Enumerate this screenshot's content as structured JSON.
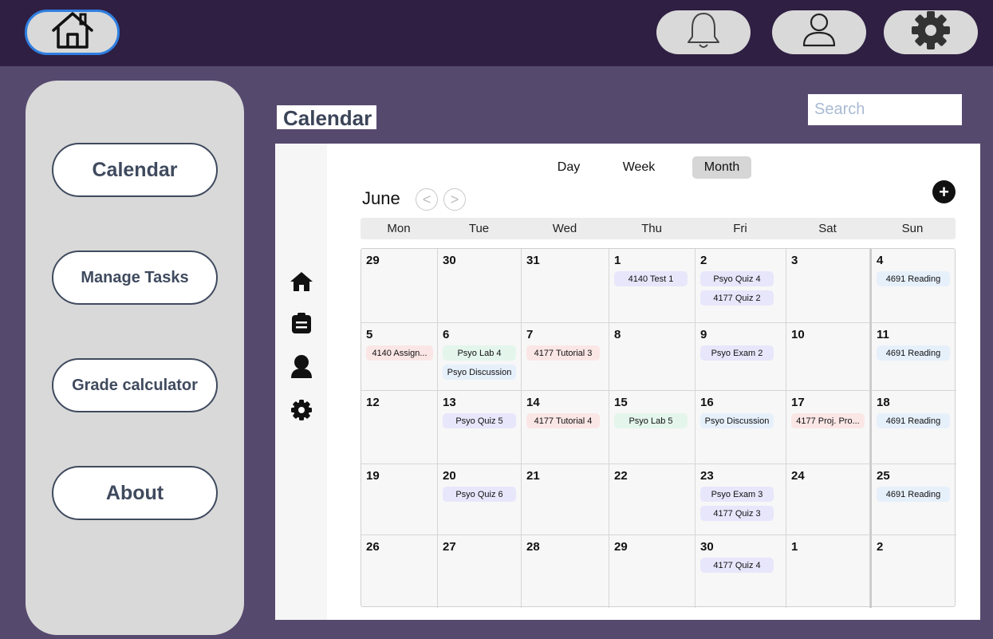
{
  "topbar": {
    "home_icon": "home-icon",
    "bell_icon": "bell-icon",
    "user_icon": "user-icon",
    "gear_icon": "gear-icon",
    "accent": "#2f7fe0"
  },
  "sidebar": {
    "items": [
      {
        "label": "Calendar"
      },
      {
        "label": "Manage Tasks"
      },
      {
        "label": "Grade calculator"
      },
      {
        "label": "About"
      }
    ]
  },
  "page": {
    "title": "Calendar"
  },
  "search": {
    "placeholder": "Search",
    "value": ""
  },
  "rail": {
    "icons": [
      "home-icon",
      "clipboard-icon",
      "person-icon",
      "gear-icon"
    ]
  },
  "calendar": {
    "views": [
      "Day",
      "Week",
      "Month"
    ],
    "active_view": "Month",
    "month": "June",
    "prev_label": "<",
    "next_label": ">",
    "add_label": "+",
    "weekdays": [
      "Mon",
      "Tue",
      "Wed",
      "Thu",
      "Fri",
      "Sat",
      "Sun"
    ],
    "weeks": [
      [
        {
          "day": "29",
          "events": []
        },
        {
          "day": "30",
          "events": []
        },
        {
          "day": "31",
          "events": []
        },
        {
          "day": "1",
          "events": [
            {
              "title": "4140 Test 1",
              "color": "#e8e6fb"
            }
          ]
        },
        {
          "day": "2",
          "events": [
            {
              "title": "Psyo Quiz 4",
              "color": "#e8e6fb"
            },
            {
              "title": "4177 Quiz 2",
              "color": "#e8e6fb"
            }
          ]
        },
        {
          "day": "3",
          "events": []
        },
        {
          "day": "4",
          "events": [
            {
              "title": "4691 Reading",
              "color": "#e6f0fb"
            }
          ]
        }
      ],
      [
        {
          "day": "5",
          "events": [
            {
              "title": "4140 Assign...",
              "color": "#fbe6e6"
            }
          ]
        },
        {
          "day": "6",
          "events": [
            {
              "title": "Psyo Lab 4",
              "color": "#e4f6ec"
            },
            {
              "title": "Psyo Discussion",
              "color": "#e6f0fb"
            }
          ]
        },
        {
          "day": "7",
          "events": [
            {
              "title": "4177 Tutorial 3",
              "color": "#fbe6e6"
            }
          ]
        },
        {
          "day": "8",
          "events": []
        },
        {
          "day": "9",
          "events": [
            {
              "title": "Psyo Exam 2",
              "color": "#e8e6fb"
            }
          ]
        },
        {
          "day": "10",
          "events": []
        },
        {
          "day": "11",
          "events": [
            {
              "title": "4691 Reading",
              "color": "#e6f0fb"
            }
          ]
        }
      ],
      [
        {
          "day": "12",
          "events": []
        },
        {
          "day": "13",
          "events": [
            {
              "title": "Psyo Quiz 5",
              "color": "#e8e6fb"
            }
          ]
        },
        {
          "day": "14",
          "events": [
            {
              "title": "4177 Tutorial 4",
              "color": "#fbe6e6"
            }
          ]
        },
        {
          "day": "15",
          "events": [
            {
              "title": "Psyo Lab 5",
              "color": "#e4f6ec"
            }
          ]
        },
        {
          "day": "16",
          "events": [
            {
              "title": "Psyo Discussion",
              "color": "#e6f0fb"
            }
          ]
        },
        {
          "day": "17",
          "events": [
            {
              "title": "4177 Proj. Pro...",
              "color": "#fbe6e6"
            }
          ]
        },
        {
          "day": "18",
          "events": [
            {
              "title": "4691 Reading",
              "color": "#e6f0fb"
            }
          ]
        }
      ],
      [
        {
          "day": "19",
          "events": []
        },
        {
          "day": "20",
          "events": [
            {
              "title": "Psyo Quiz 6",
              "color": "#e8e6fb"
            }
          ]
        },
        {
          "day": "21",
          "events": []
        },
        {
          "day": "22",
          "events": []
        },
        {
          "day": "23",
          "events": [
            {
              "title": "Psyo Exam 3",
              "color": "#e8e6fb"
            },
            {
              "title": "4177 Quiz 3",
              "color": "#e8e6fb"
            }
          ]
        },
        {
          "day": "24",
          "events": []
        },
        {
          "day": "25",
          "events": [
            {
              "title": "4691 Reading",
              "color": "#e6f0fb"
            }
          ]
        }
      ],
      [
        {
          "day": "26",
          "events": []
        },
        {
          "day": "27",
          "events": []
        },
        {
          "day": "28",
          "events": []
        },
        {
          "day": "29",
          "events": []
        },
        {
          "day": "30",
          "events": [
            {
              "title": "4177 Quiz 4",
              "color": "#e8e6fb"
            }
          ]
        },
        {
          "day": "1",
          "events": []
        },
        {
          "day": "2",
          "events": []
        }
      ]
    ]
  }
}
